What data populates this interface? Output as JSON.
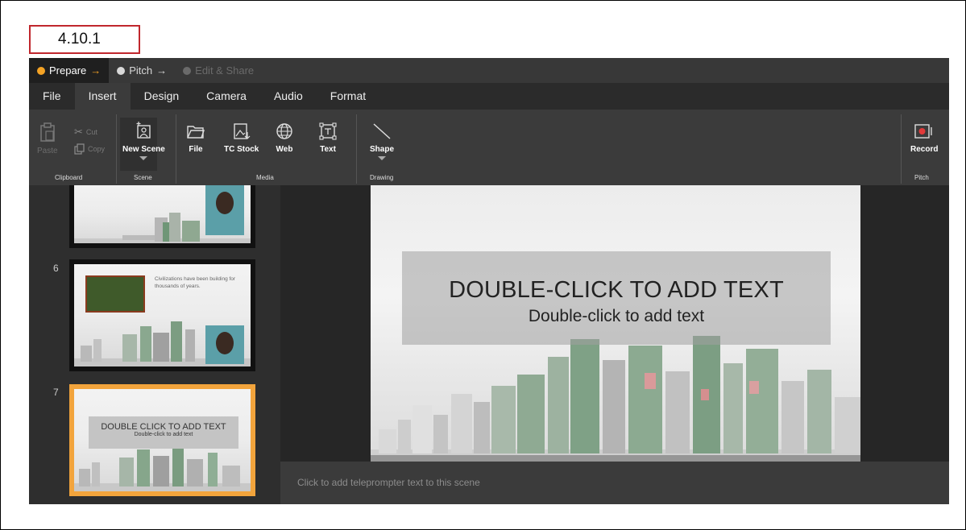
{
  "figure_label": "4.10.1",
  "steps": [
    {
      "label": "Prepare",
      "arrow": "→",
      "state": "active"
    },
    {
      "label": "Pitch",
      "arrow": "→",
      "state": "normal"
    },
    {
      "label": "Edit & Share",
      "arrow": "",
      "state": "disabled"
    }
  ],
  "menu_tabs": [
    "File",
    "Insert",
    "Design",
    "Camera",
    "Audio",
    "Format"
  ],
  "active_menu_tab": "Insert",
  "ribbon": {
    "paste": "Paste",
    "cut": "Cut",
    "copy": "Copy",
    "clipboard_group": "Clipboard",
    "new_scene": "New Scene",
    "scene_group": "Scene",
    "file": "File",
    "tc_stock": "TC Stock",
    "web": "Web",
    "text": "Text",
    "media_group": "Media",
    "shape": "Shape",
    "drawing_group": "Drawing",
    "record": "Record",
    "pitch_group": "Pitch"
  },
  "scenes": [
    {
      "number": "",
      "text": ""
    },
    {
      "number": "6",
      "text": "Civilizations have been building for thousands of years."
    },
    {
      "number": "7",
      "title": "DOUBLE CLICK TO ADD TEXT",
      "subtitle": "Double-click to add text",
      "selected": true
    }
  ],
  "slide": {
    "title": "DOUBLE-CLICK TO ADD TEXT",
    "subtitle": "Double-click to add text"
  },
  "teleprompter_placeholder": "Click to add teleprompter text to this scene",
  "colors": {
    "accent": "#f4a325",
    "record": "#e23a3a",
    "label_border": "#c0272d"
  }
}
